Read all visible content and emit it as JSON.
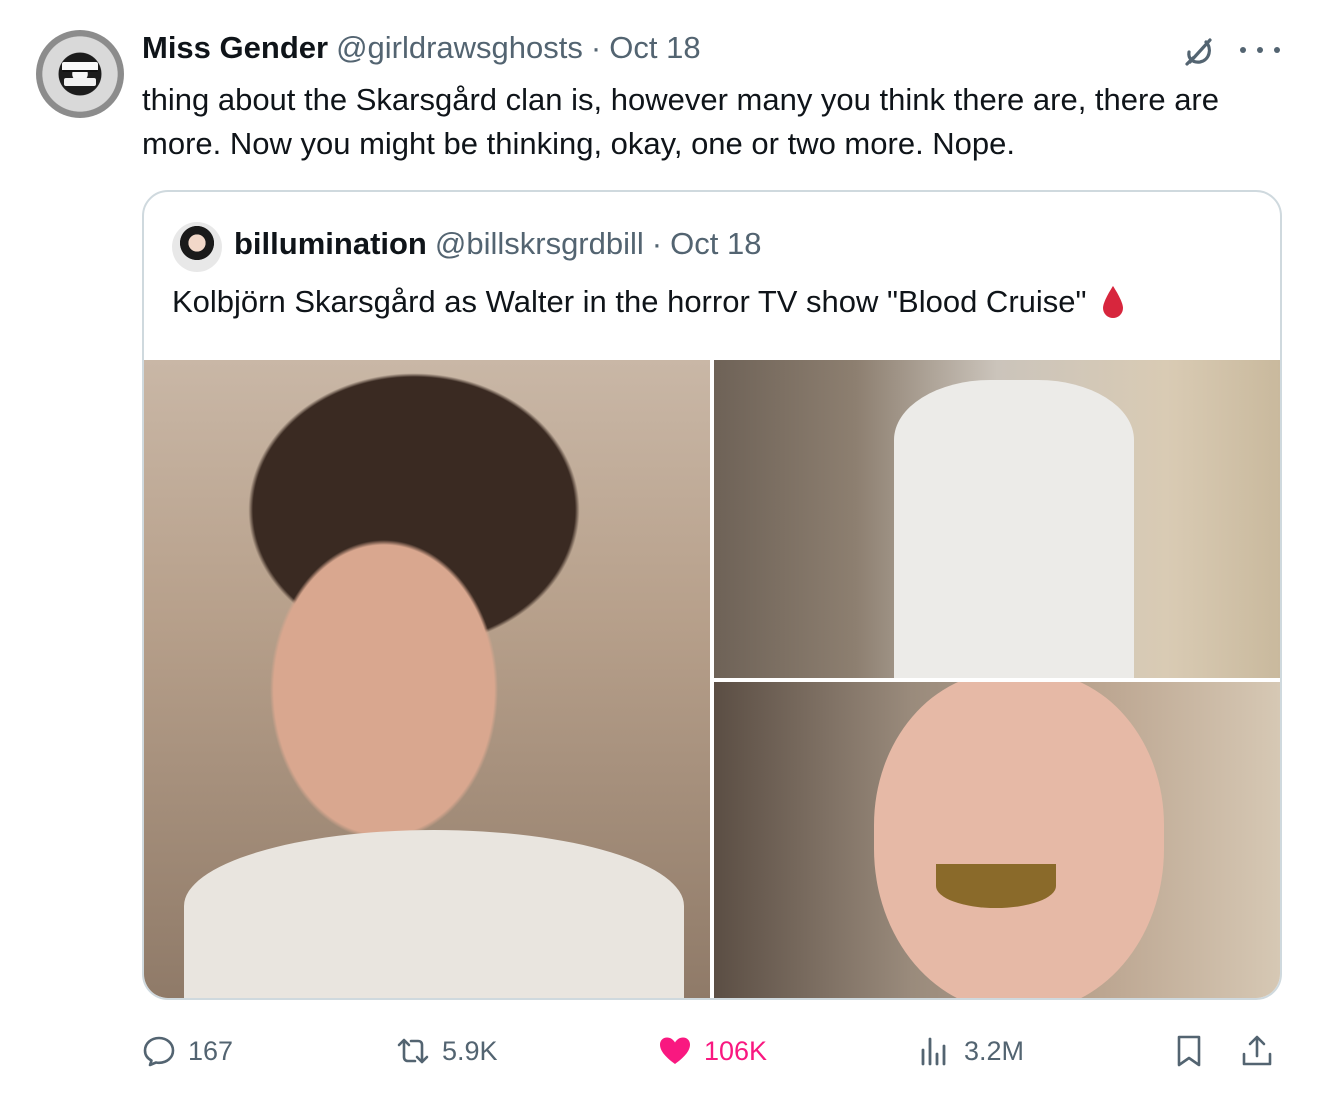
{
  "tweet": {
    "author": {
      "display_name": "Miss Gender",
      "handle": "@girldrawsghosts",
      "separator": "·",
      "date": "Oct 18"
    },
    "text": "thing about the Skarsgård clan is, however many you think there are, there are more. Now you might be thinking, okay, one or two more. Nope.",
    "icons": [
      "grok-icon",
      "more-icon"
    ]
  },
  "quote": {
    "author": {
      "display_name": "billumination",
      "handle": "@billskrsgrdbill",
      "separator": "·",
      "date": "Oct 18"
    },
    "text": "Kolbjörn Skarsgård as Walter in the horror TV show \"Blood Cruise\"",
    "emoji_icon": "blood-drop-icon",
    "media_count": 3
  },
  "actions": {
    "replies": "167",
    "retweets": "5.9K",
    "likes": "106K",
    "views": "3.2M"
  },
  "colors": {
    "text_primary": "#0f1419",
    "text_secondary": "#536471",
    "like_pink": "#f91880",
    "border": "#cfd9de",
    "blood_red": "#d7263d"
  }
}
